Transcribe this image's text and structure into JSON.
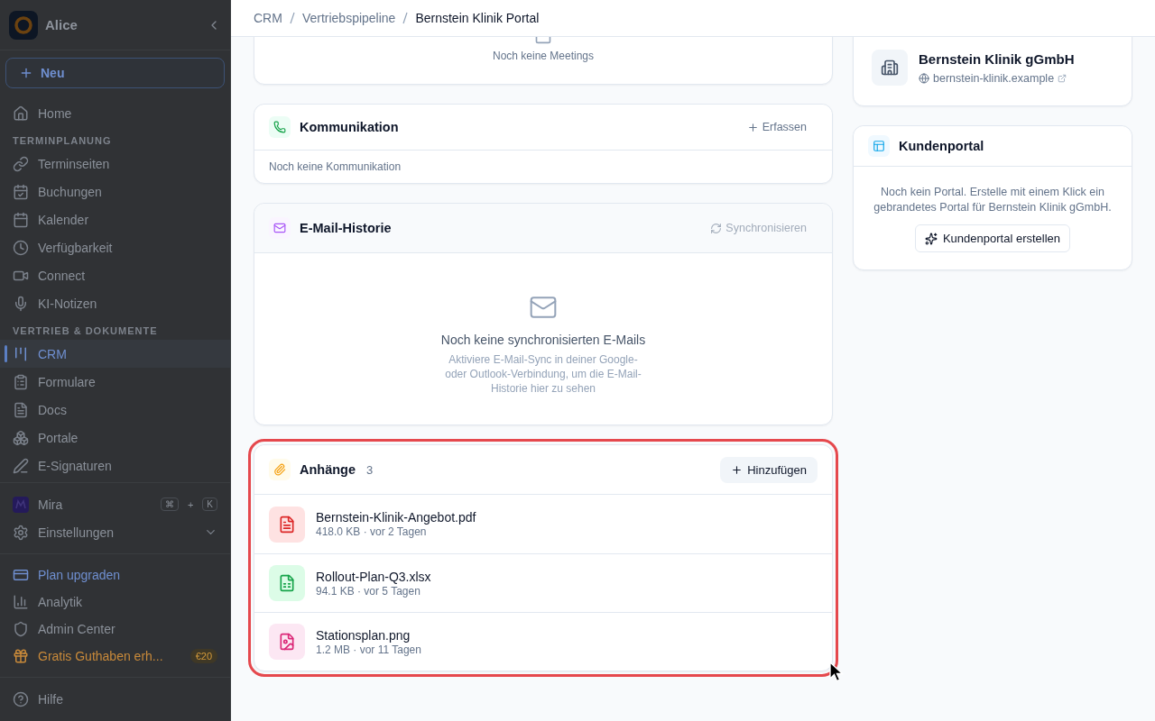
{
  "sidebar": {
    "workspace": "Alice",
    "new_button": "Neu",
    "nav": [
      {
        "label": "Home",
        "selected": false
      }
    ],
    "sections": [
      {
        "title": "TERMINPLANUNG",
        "items": [
          {
            "label": "Terminseiten",
            "selected": false
          },
          {
            "label": "Buchungen",
            "selected": false
          },
          {
            "label": "Kalender",
            "selected": false
          },
          {
            "label": "Verfügbarkeit",
            "selected": false
          },
          {
            "label": "Connect",
            "selected": false
          },
          {
            "label": "KI-Notizen",
            "selected": false
          }
        ]
      },
      {
        "title": "VERTRIEB & DOKUMENTE",
        "items": [
          {
            "label": "CRM",
            "selected": true
          },
          {
            "label": "Formulare",
            "selected": false
          },
          {
            "label": "Docs",
            "selected": false
          },
          {
            "label": "Portale",
            "selected": false
          },
          {
            "label": "E-Signaturen",
            "selected": false
          }
        ]
      }
    ],
    "assistant": {
      "label": "Mira",
      "keys": [
        "⌘",
        "K"
      ],
      "joiner": "+"
    },
    "settings": {
      "label": "Einstellungen",
      "expanded": false
    },
    "footer": [
      {
        "kind": "upgrade",
        "label": "Plan upgraden"
      },
      {
        "kind": "link",
        "label": "Analytik"
      },
      {
        "kind": "link",
        "label": "Admin Center"
      },
      {
        "kind": "promo",
        "label": "Gratis Guthaben erh...",
        "badge": "€20"
      }
    ],
    "help": "Hilfe"
  },
  "breadcrumb": [
    "CRM",
    "Vertriebspipeline",
    "Bernstein Klinik Portal"
  ],
  "meetings": {
    "empty_text": "Noch keine Meetings"
  },
  "communication": {
    "title": "Kommunikation",
    "action": "Erfassen",
    "empty_text": "Noch keine Kommunikation"
  },
  "email": {
    "title": "E-Mail-Historie",
    "action": "Synchronisieren",
    "action_disabled": true,
    "empty_title": "Noch keine synchronisierten E-Mails",
    "empty_text": "Aktiviere E-Mail-Sync in deiner Google- oder Outlook-Verbindung, um die E-Mail-Historie hier zu sehen"
  },
  "attachments": {
    "title": "Anhänge",
    "count": "3",
    "add_button": "Hinzufügen",
    "highlighted": true,
    "files": [
      {
        "kind": "pdf",
        "name": "Bernstein-Klinik-Angebot.pdf",
        "meta": "418.0 KB · vor 2 Tagen"
      },
      {
        "kind": "sheet",
        "name": "Rollout-Plan-Q3.xlsx",
        "meta": "94.1 KB · vor 5 Tagen"
      },
      {
        "kind": "image",
        "name": "Stationsplan.png",
        "meta": "1.2 MB · vor 11 Tagen"
      }
    ]
  },
  "company": {
    "name": "Bernstein Klinik gGmbH",
    "website": "bernstein-klinik.example"
  },
  "portal": {
    "title": "Kundenportal",
    "text": "Noch kein Portal. Erstelle mit einem Klick ein gebrandetes Portal für Bernstein Klinik gGmbH.",
    "button": "Kundenportal erstellen"
  }
}
